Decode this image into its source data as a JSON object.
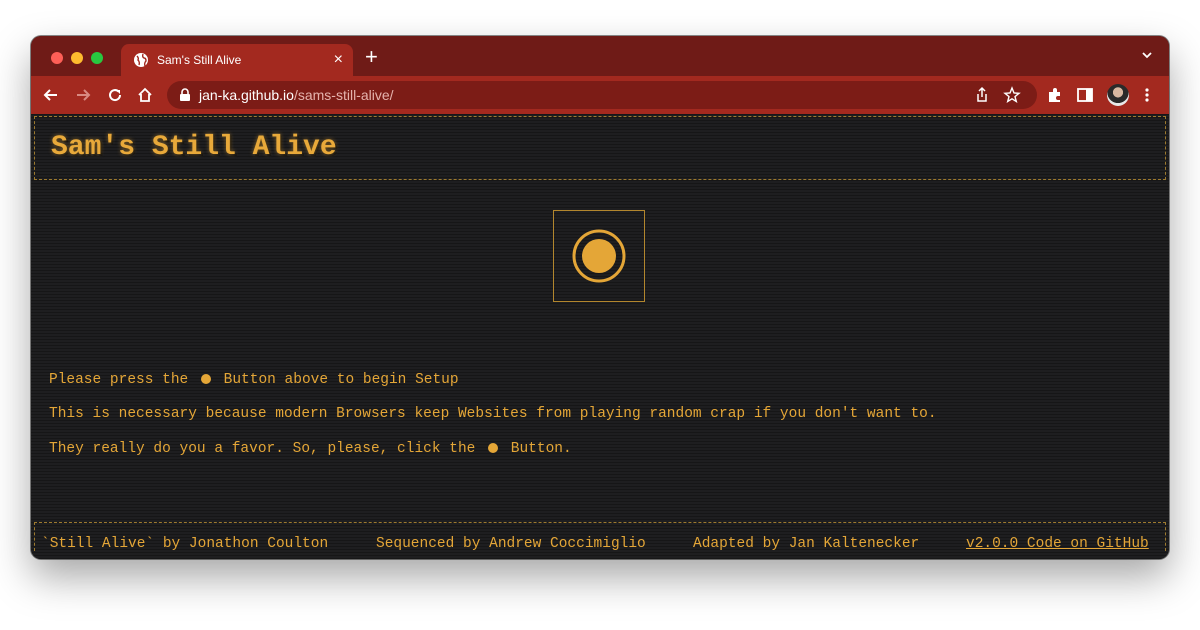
{
  "browser": {
    "tab_title": "Sam's Still Alive",
    "tab_close": "×",
    "new_tab": "+",
    "url_host": "jan-ka.github.io",
    "url_path": "/sams-still-alive/",
    "chrome_color": "#a3291f",
    "tabstrip_color": "#6f1b17"
  },
  "page": {
    "title": "Sam's Still Alive",
    "accent_color": "#e4a637",
    "start_button_icon": "record-icon",
    "messages": {
      "line1_before": "Please press the",
      "line1_after": "Button above to begin Setup",
      "line2": "This is necessary because modern Browsers keep Websites from playing random crap if you don't want to.",
      "line3_before": "They really do you a favor. So, please, click the",
      "line3_after": "Button."
    },
    "footer": {
      "credit_song": "`Still Alive` by Jonathon Coulton",
      "credit_sequence": "Sequenced by Andrew Coccimiglio",
      "credit_adapted": "Adapted by Jan Kaltenecker",
      "version_link": "v2.0.0 Code on GitHub"
    }
  }
}
